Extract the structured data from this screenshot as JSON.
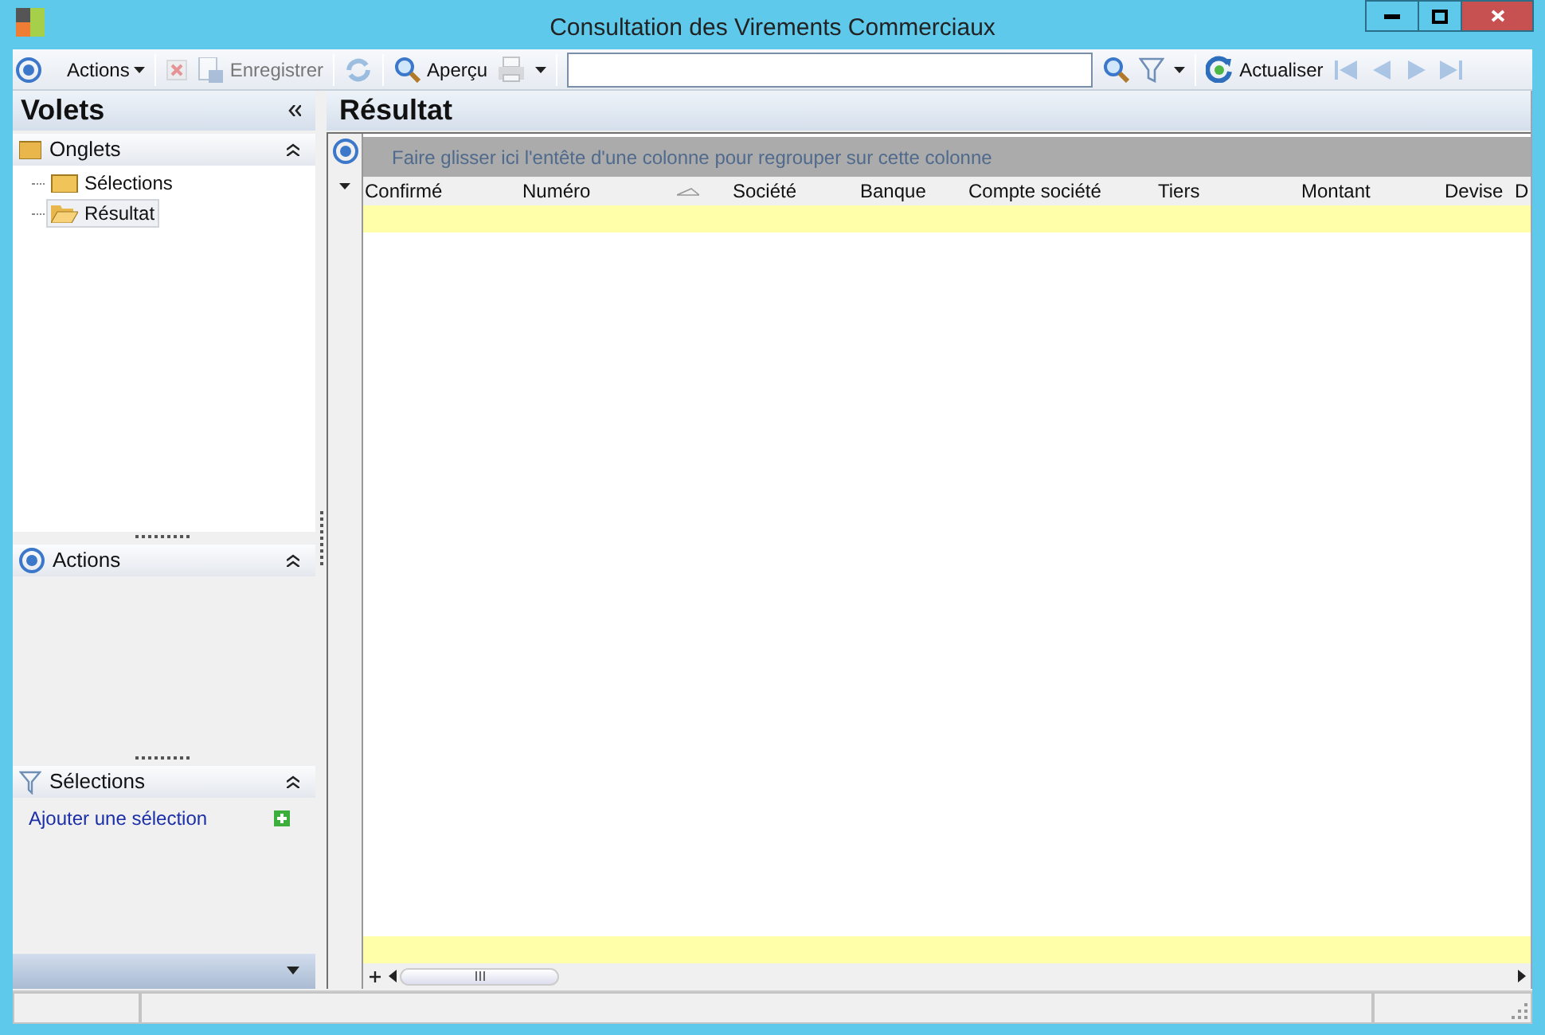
{
  "window": {
    "title": "Consultation des Virements Commerciaux"
  },
  "toolbar": [
    {
      "kind": "target",
      "disabled": false
    },
    {
      "kind": "menu",
      "label": "Actions",
      "disabled": false
    },
    {
      "kind": "sep"
    },
    {
      "kind": "delete",
      "disabled": true
    },
    {
      "kind": "save",
      "label": "Enregistrer",
      "disabled": true
    },
    {
      "kind": "sep"
    },
    {
      "kind": "sync",
      "disabled": true
    },
    {
      "kind": "sep"
    },
    {
      "kind": "preview",
      "label": "Aperçu",
      "disabled": false
    },
    {
      "kind": "print",
      "disabled": true
    },
    {
      "kind": "dropdown",
      "disabled": false
    },
    {
      "kind": "sep"
    },
    {
      "kind": "search-field",
      "disabled": false
    },
    {
      "kind": "search",
      "disabled": false
    },
    {
      "kind": "filter",
      "disabled": false
    },
    {
      "kind": "dropdown",
      "disabled": false
    },
    {
      "kind": "sep"
    },
    {
      "kind": "refresh",
      "label": "Actualiser",
      "disabled": false
    },
    {
      "kind": "first",
      "disabled": true
    },
    {
      "kind": "prev",
      "disabled": true
    },
    {
      "kind": "next",
      "disabled": true
    },
    {
      "kind": "last",
      "disabled": true
    }
  ],
  "sidebar": {
    "title": "Volets",
    "panes": [
      {
        "kind": "tree",
        "title": "Onglets",
        "expanded": true,
        "items": [
          {
            "label": "Sélections",
            "selected": false
          },
          {
            "label": "Résultat",
            "selected": true
          }
        ]
      },
      {
        "kind": "actions",
        "title": "Actions",
        "expanded": true
      },
      {
        "kind": "selections",
        "title": "Sélections",
        "expanded": true,
        "link": "Ajouter une sélection"
      }
    ]
  },
  "main": {
    "title": "Résultat",
    "group_hint": "Faire glisser ici l'entête d'une colonne pour regrouper sur cette colonne",
    "columns": [
      {
        "label": "Confirmé",
        "sorted": false
      },
      {
        "label": "Numéro",
        "sorted": true
      },
      {
        "label": "Société",
        "sorted": false
      },
      {
        "label": "Banque",
        "sorted": false
      },
      {
        "label": "Compte société",
        "sorted": false
      },
      {
        "label": "Tiers",
        "sorted": false
      },
      {
        "label": "Montant",
        "sorted": false
      },
      {
        "label": "Devise",
        "sorted": false
      },
      {
        "label": "D",
        "sorted": false
      }
    ]
  }
}
